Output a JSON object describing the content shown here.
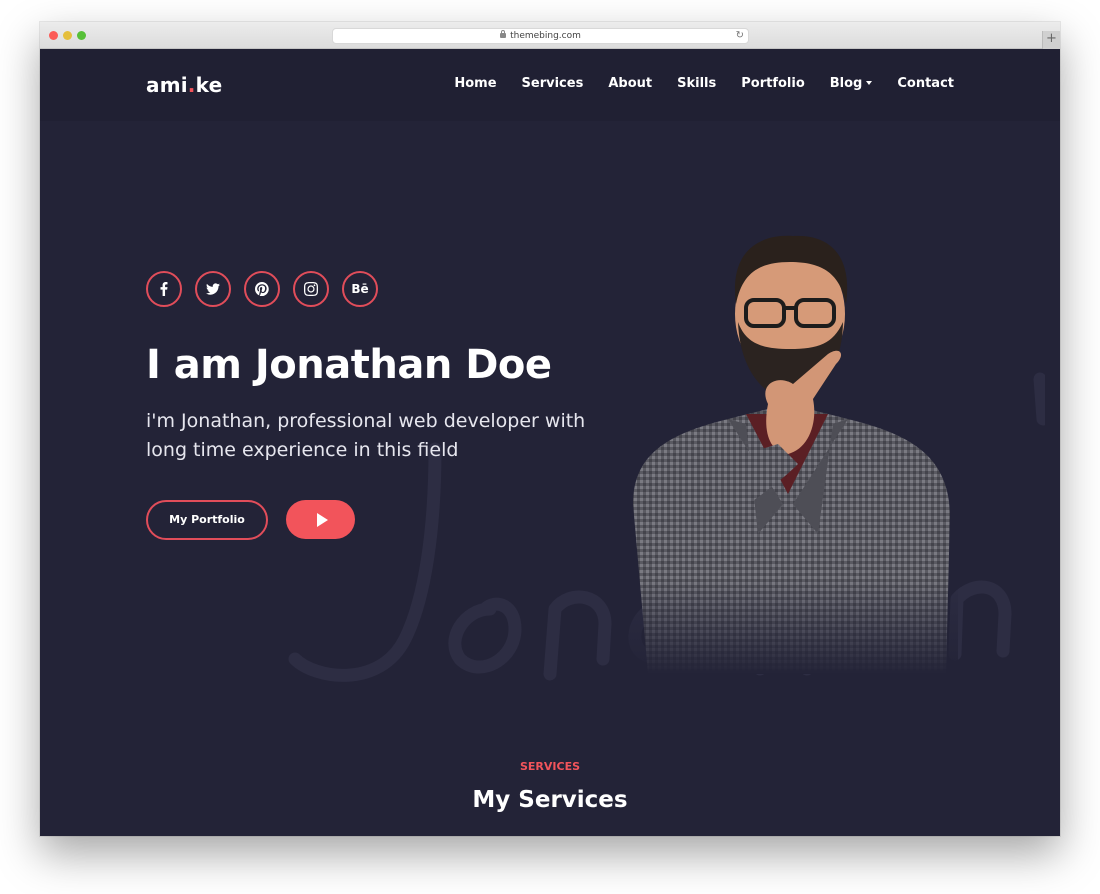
{
  "browser": {
    "url": "themebing.com"
  },
  "site": {
    "logo_main": "ami",
    "logo_dot": ".",
    "logo_end": "ke"
  },
  "nav": {
    "items": [
      {
        "label": "Home"
      },
      {
        "label": "Services"
      },
      {
        "label": "About"
      },
      {
        "label": "Skills"
      },
      {
        "label": "Portfolio"
      },
      {
        "label": "Blog"
      },
      {
        "label": "Contact"
      }
    ]
  },
  "socials": [
    {
      "icon": "facebook-icon"
    },
    {
      "icon": "twitter-icon"
    },
    {
      "icon": "pinterest-icon"
    },
    {
      "icon": "instagram-icon"
    },
    {
      "icon": "behance-icon",
      "text": "Bē"
    }
  ],
  "hero": {
    "title": "I am Jonathan Doe",
    "subtitle": "i'm Jonathan, professional web developer with long time experience in this field",
    "portfolio_button": "My Portfolio",
    "play_icon": "play-icon",
    "background_script": "Jonathan"
  },
  "services": {
    "label": "SERVICES",
    "title": "My Services"
  },
  "colors": {
    "background": "#232337",
    "accent": "#f2545b",
    "text": "#ffffff"
  }
}
